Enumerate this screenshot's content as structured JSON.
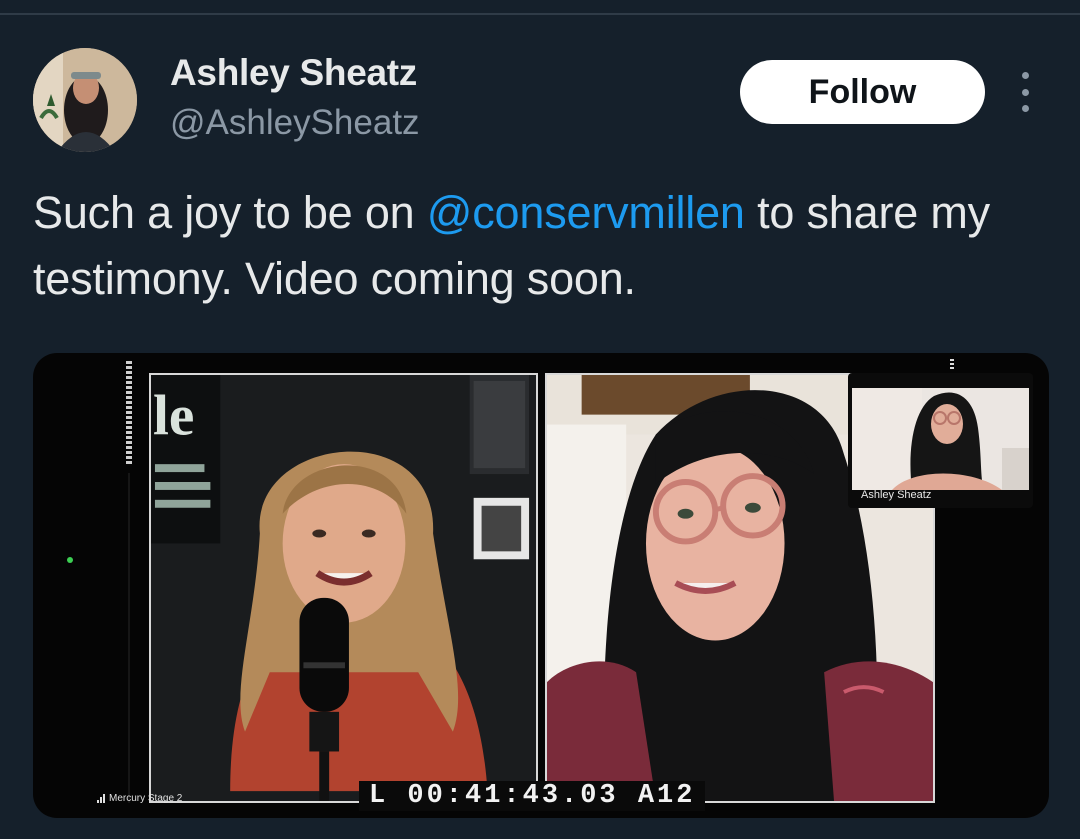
{
  "tweet": {
    "author": {
      "display_name": "Ashley Sheatz",
      "handle": "@AshleySheatz"
    },
    "follow_label": "Follow",
    "more_icon": "more-vertical-icon",
    "text_before": "Such a joy to be on ",
    "mention": "@conservmillen",
    "text_after": " to share my testimony. Video coming soon."
  },
  "media": {
    "pip_name": "Ashley Sheatz",
    "timecode": "L 00:41:43.03 A12",
    "stage_label": "Mercury Stage 2",
    "stage_icon": "signal-bars-icon"
  },
  "colors": {
    "background": "#15202b",
    "text_primary": "#e7e9ea",
    "text_secondary": "#8b98a5",
    "mention": "#1d9bf0",
    "follow_bg": "#ffffff"
  }
}
